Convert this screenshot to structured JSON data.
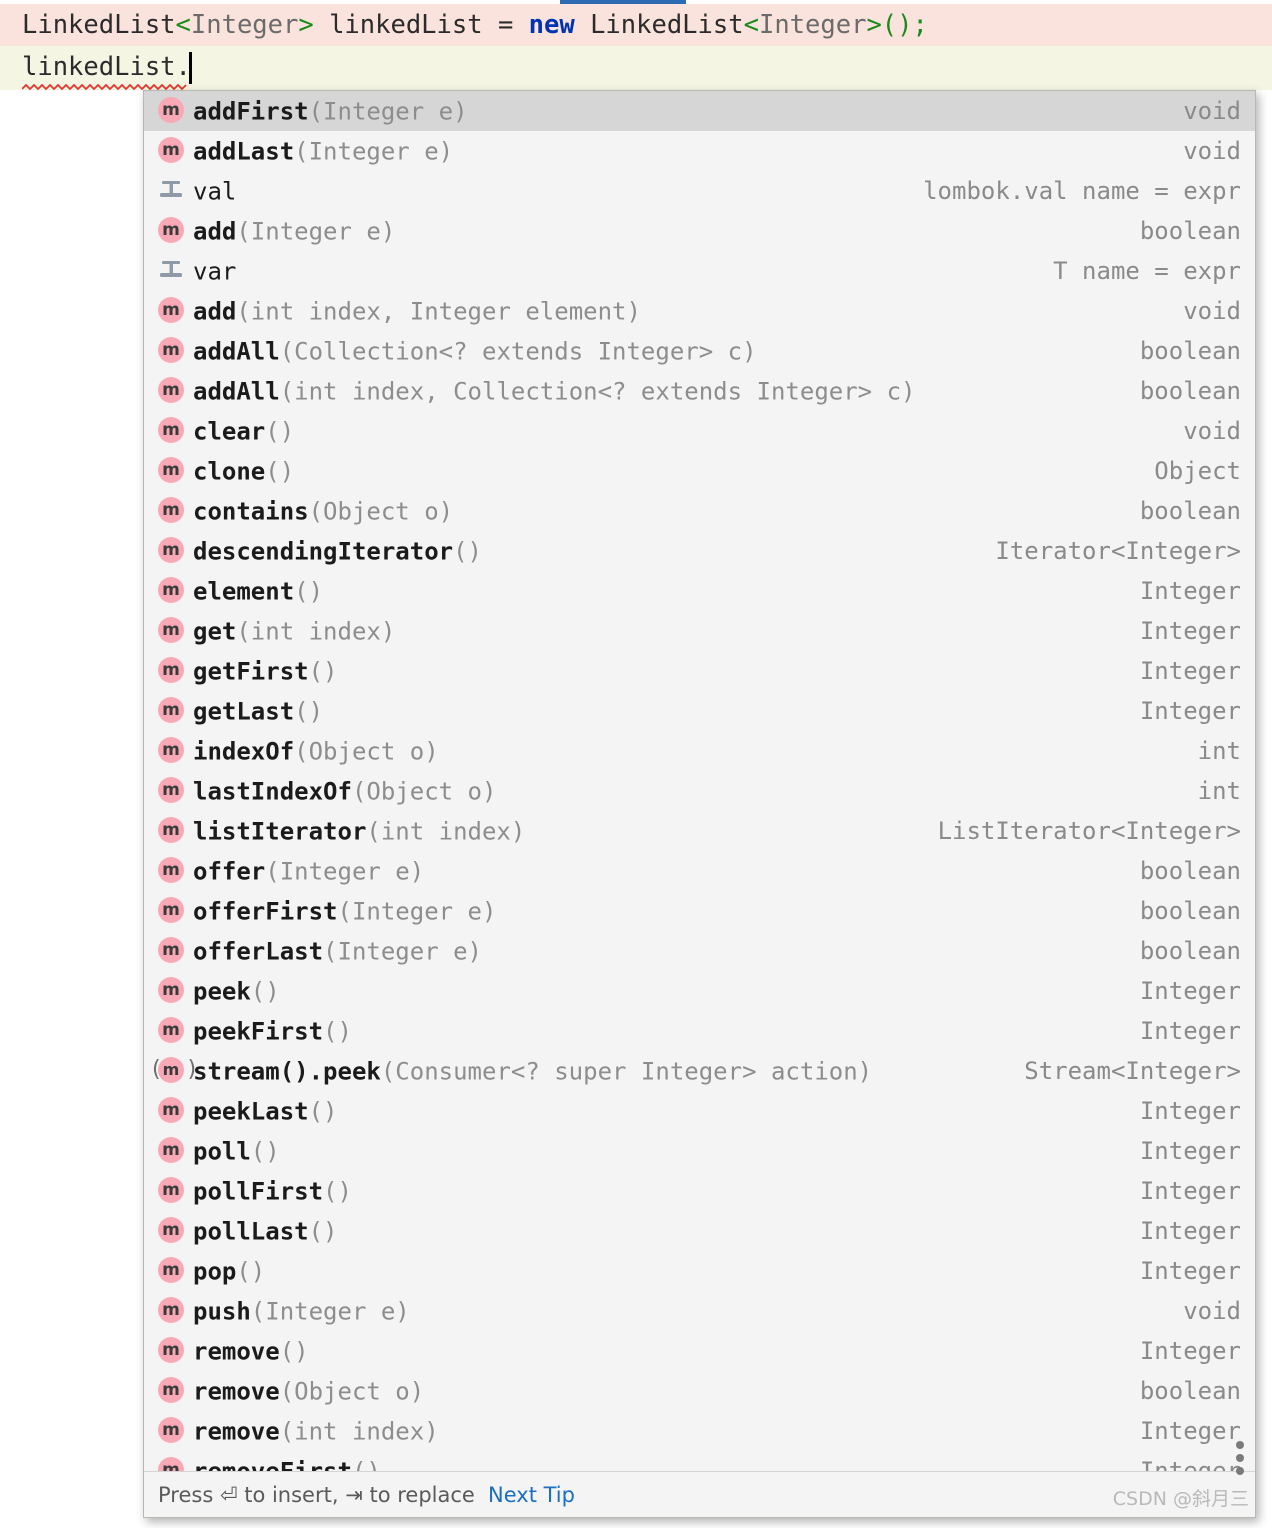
{
  "editor": {
    "line1": {
      "part1": "LinkedList",
      "generic1": "<Integer>",
      "part2": " linkedList = ",
      "kw": "new",
      "part3": " LinkedList",
      "generic2_open": "<",
      "generic2_type": "Integer",
      "generic2_close": ">",
      "tail": "();",
      "full": "LinkedList<Integer> linkedList = new LinkedList<Integer>();"
    },
    "line2": {
      "text": "linkedList.",
      "full": "linkedList."
    }
  },
  "popup": {
    "selected_index": 0,
    "items": [
      {
        "icon": "method-icon",
        "name": "addFirst",
        "params": "(Integer e)",
        "type": "void"
      },
      {
        "icon": "method-icon",
        "name": "addLast",
        "params": "(Integer e)",
        "type": "void"
      },
      {
        "icon": "live-template-icon",
        "name": "val",
        "params": "",
        "type": "lombok.val name = expr"
      },
      {
        "icon": "method-icon",
        "name": "add",
        "params": "(Integer e)",
        "type": "boolean"
      },
      {
        "icon": "live-template-icon",
        "name": "var",
        "params": "",
        "type": "T name = expr"
      },
      {
        "icon": "method-icon",
        "name": "add",
        "params": "(int index, Integer element)",
        "type": "void"
      },
      {
        "icon": "method-icon",
        "name": "addAll",
        "params": "(Collection<? extends Integer> c)",
        "type": "boolean"
      },
      {
        "icon": "method-icon",
        "name": "addAll",
        "params": "(int index, Collection<? extends Integer> c)",
        "type": "boolean"
      },
      {
        "icon": "method-icon",
        "name": "clear",
        "params": "()",
        "type": "void"
      },
      {
        "icon": "method-icon",
        "name": "clone",
        "params": "()",
        "type": "Object"
      },
      {
        "icon": "method-icon",
        "name": "contains",
        "params": "(Object o)",
        "type": "boolean"
      },
      {
        "icon": "method-icon",
        "name": "descendingIterator",
        "params": "()",
        "type": "Iterator<Integer>"
      },
      {
        "icon": "method-icon",
        "name": "element",
        "params": "()",
        "type": "Integer"
      },
      {
        "icon": "method-icon",
        "name": "get",
        "params": "(int index)",
        "type": "Integer"
      },
      {
        "icon": "method-icon",
        "name": "getFirst",
        "params": "()",
        "type": "Integer"
      },
      {
        "icon": "method-icon",
        "name": "getLast",
        "params": "()",
        "type": "Integer"
      },
      {
        "icon": "method-icon",
        "name": "indexOf",
        "params": "(Object o)",
        "type": "int"
      },
      {
        "icon": "method-icon",
        "name": "lastIndexOf",
        "params": "(Object o)",
        "type": "int"
      },
      {
        "icon": "method-icon",
        "name": "listIterator",
        "params": "(int index)",
        "type": "ListIterator<Integer>"
      },
      {
        "icon": "method-icon",
        "name": "offer",
        "params": "(Integer e)",
        "type": "boolean"
      },
      {
        "icon": "method-icon",
        "name": "offerFirst",
        "params": "(Integer e)",
        "type": "boolean"
      },
      {
        "icon": "method-icon",
        "name": "offerLast",
        "params": "(Integer e)",
        "type": "boolean"
      },
      {
        "icon": "method-icon",
        "name": "peek",
        "params": "()",
        "type": "Integer"
      },
      {
        "icon": "method-icon",
        "name": "peekFirst",
        "params": "()",
        "type": "Integer"
      },
      {
        "icon": "chained-method-icon",
        "name": "stream().peek",
        "params": "(Consumer<? super Integer> action)",
        "type": "Stream<Integer>"
      },
      {
        "icon": "method-icon",
        "name": "peekLast",
        "params": "()",
        "type": "Integer"
      },
      {
        "icon": "method-icon",
        "name": "poll",
        "params": "()",
        "type": "Integer"
      },
      {
        "icon": "method-icon",
        "name": "pollFirst",
        "params": "()",
        "type": "Integer"
      },
      {
        "icon": "method-icon",
        "name": "pollLast",
        "params": "()",
        "type": "Integer"
      },
      {
        "icon": "method-icon",
        "name": "pop",
        "params": "()",
        "type": "Integer"
      },
      {
        "icon": "method-icon",
        "name": "push",
        "params": "(Integer e)",
        "type": "void"
      },
      {
        "icon": "method-icon",
        "name": "remove",
        "params": "()",
        "type": "Integer"
      },
      {
        "icon": "method-icon",
        "name": "remove",
        "params": "(Object o)",
        "type": "boolean"
      },
      {
        "icon": "method-icon",
        "name": "remove",
        "params": "(int index)",
        "type": "Integer"
      },
      {
        "icon": "method-icon",
        "name": "removeFirst",
        "params": "()",
        "type": "Integer"
      }
    ]
  },
  "statusbar": {
    "hint": "Press ⏎ to insert, ⇥ to replace",
    "next_tip": "Next Tip"
  },
  "watermark": {
    "text": "CSDN @斜月三"
  },
  "colors": {
    "selection_bg": "#d6d6d6",
    "popup_bg": "#f4f4f4",
    "method_icon_bg": "#f9a8b6",
    "link": "#1a6fc4",
    "code_line_highlight": "#fae3dd",
    "caret_line": "#f5f5e3",
    "keyword": "#0033b3",
    "generic_bracket": "#1a8a1a",
    "top_bar": "#2d6bb5"
  }
}
